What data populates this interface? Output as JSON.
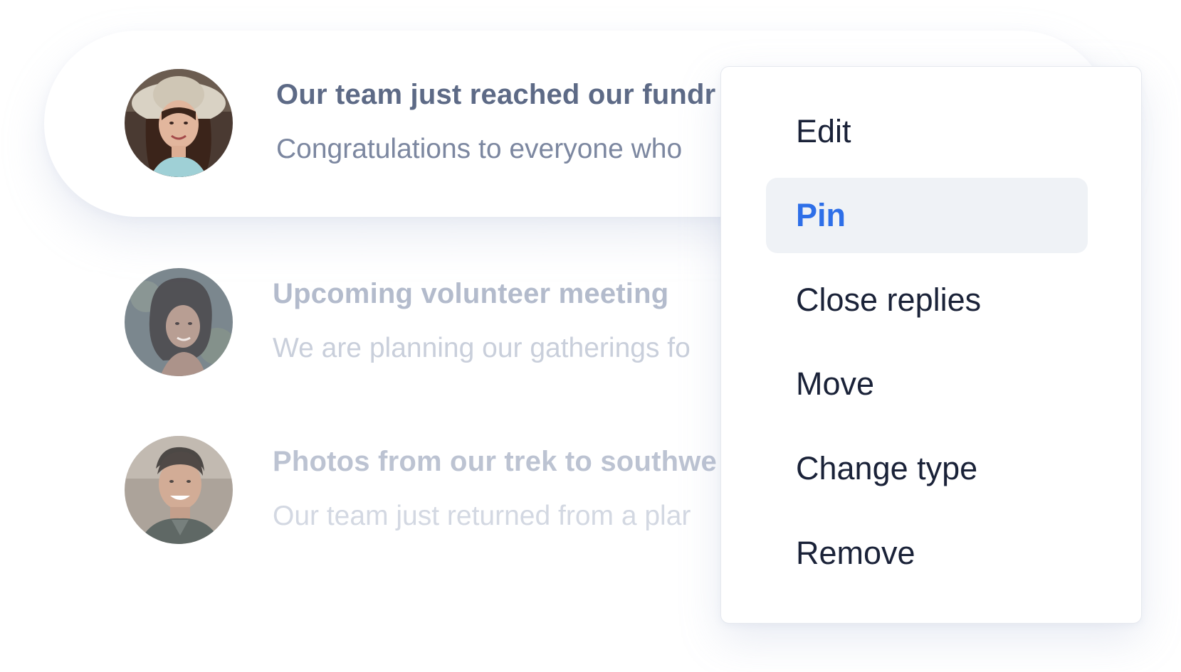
{
  "threads": [
    {
      "title": "Our team just reached our fundr",
      "snippet": "Congratulations to everyone who",
      "avatar_icon": "woman-with-hat-avatar"
    },
    {
      "title": "Upcoming volunteer meeting",
      "snippet": "We are planning our gatherings fo",
      "avatar_icon": "woman-with-curly-hair-avatar"
    },
    {
      "title": "Photos from our trek to southwe",
      "snippet": "Our team just returned from a plar",
      "avatar_icon": "smiling-man-avatar"
    }
  ],
  "menu": {
    "items": [
      {
        "label": "Edit"
      },
      {
        "label": "Pin",
        "active": true
      },
      {
        "label": "Close replies"
      },
      {
        "label": "Move"
      },
      {
        "label": "Change type"
      },
      {
        "label": "Remove"
      }
    ]
  },
  "colors": {
    "accent": "#2e6fe8",
    "menu_text": "#1a2238",
    "active_bg": "#eff2f6",
    "title_text": "#5d6a86"
  }
}
